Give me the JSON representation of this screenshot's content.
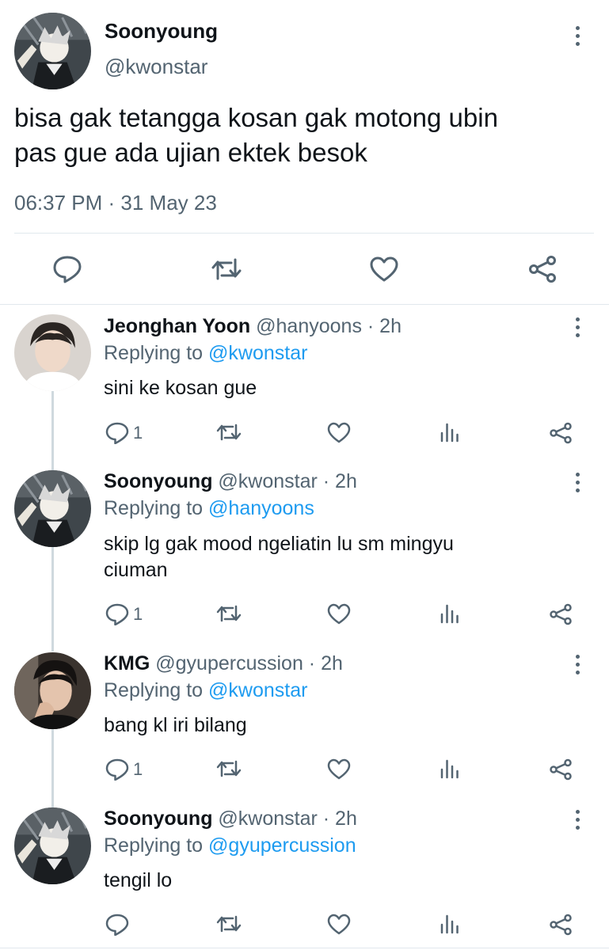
{
  "main_tweet": {
    "name": "Soonyoung",
    "handle": "@kwonstar",
    "text_line1": "bisa gak tetangga kosan gak motong ubin",
    "text_line2": "pas gue ada ujian ektek besok",
    "timestamp": "06:37 PM · 31 May 23",
    "actions": [
      "reply-icon",
      "retweet-icon",
      "like-icon",
      "share-icon"
    ]
  },
  "replies": [
    {
      "name": "Jeonghan Yoon",
      "meta": " @hanyoons · 2h",
      "replying_prefix": "Replying to ",
      "replying_to": "@kwonstar",
      "text_line1": "sini ke kosan gue",
      "text_line2": "",
      "reply_count": "1"
    },
    {
      "name": "Soonyoung",
      "meta": " @kwonstar · 2h",
      "replying_prefix": "Replying to ",
      "replying_to": "@hanyoons",
      "text_line1": "skip lg gak mood ngeliatin lu sm mingyu",
      "text_line2": "ciuman",
      "reply_count": "1"
    },
    {
      "name": "KMG",
      "meta": " @gyupercussion · 2h",
      "replying_prefix": "Replying to ",
      "replying_to": "@kwonstar",
      "text_line1": "bang kl iri bilang",
      "text_line2": "",
      "reply_count": "1"
    },
    {
      "name": "Soonyoung",
      "meta": " @kwonstar · 2h",
      "replying_prefix": "Replying to ",
      "replying_to": "@gyupercussion",
      "text_line1": "tengil lo",
      "text_line2": "",
      "reply_count": ""
    }
  ],
  "colors": {
    "link": "#1d9bf0",
    "secondary_text": "#536471",
    "divider": "#e1e8ed",
    "thread_line": "#cfd9de"
  }
}
